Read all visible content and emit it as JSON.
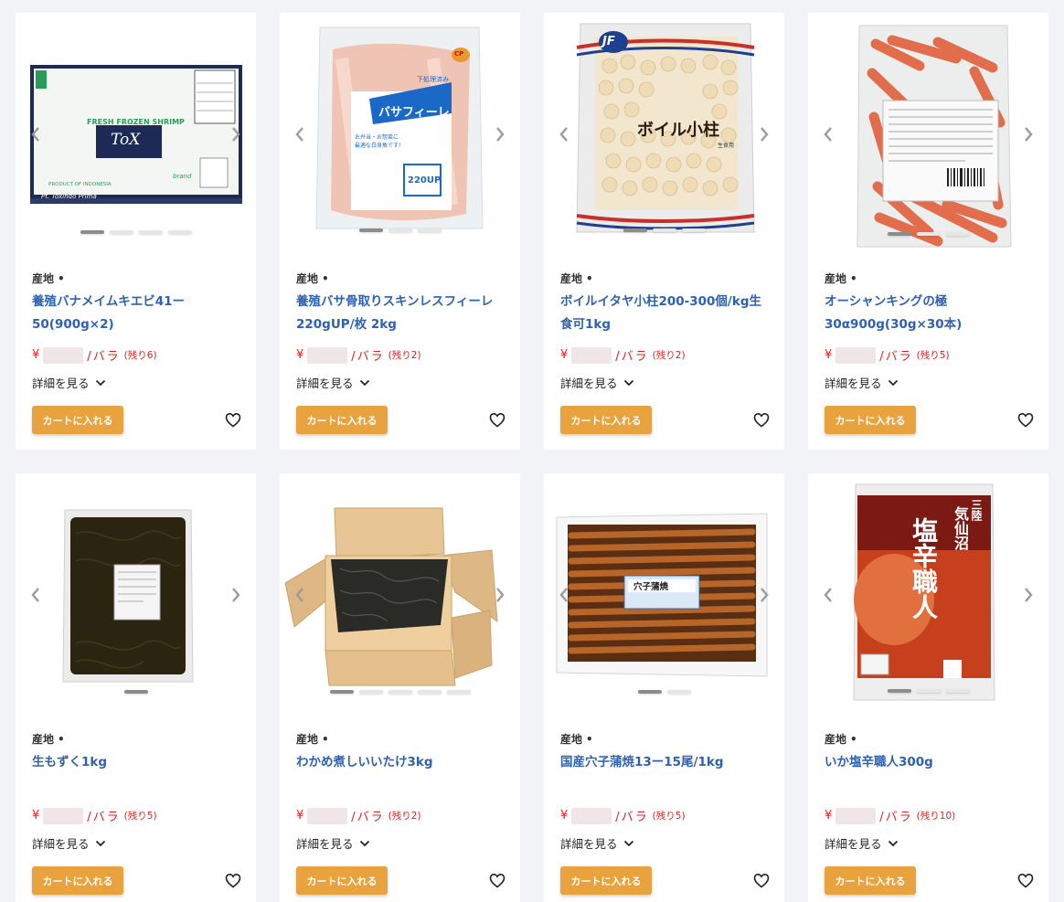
{
  "products": [
    {
      "origin_label": "産地",
      "origin_value": "•",
      "title": "養殖バナメイムキエビ41ー50(900g×2)",
      "currency": "¥",
      "unit": "/バラ",
      "stock": "(残り6)",
      "detail_label": "詳細を見る",
      "cart_label": "カートに入れる",
      "package_text": [
        "FRESH FROZEN SHRIMP",
        "ToX",
        "brand",
        "PRODUCT OF INDONESIA",
        "Pt. Toxindo Prima"
      ],
      "slide_count": 4,
      "active_slide": 0
    },
    {
      "origin_label": "産地",
      "origin_value": "•",
      "title": "養殖バサ骨取りスキンレスフィーレ220gUP/枚 2kg",
      "currency": "¥",
      "unit": "/バラ",
      "stock": "(残り2)",
      "detail_label": "詳細を見る",
      "cart_label": "カートに入れる",
      "package_text": [
        "CP",
        "下処理済み",
        "バサフィーレ",
        "お弁当・お惣菜に最適な白身魚です!",
        "220UP"
      ],
      "slide_count": 3,
      "active_slide": 0
    },
    {
      "origin_label": "産地",
      "origin_value": "•",
      "title": "ボイルイタヤ小柱200-300個/kg生食可1kg",
      "currency": "¥",
      "unit": "/バラ",
      "stock": "(残り2)",
      "detail_label": "詳細を見る",
      "cart_label": "カートに入れる",
      "package_text": [
        "JF",
        "ボイル小柱",
        "生食用"
      ],
      "slide_count": 3,
      "active_slide": 0
    },
    {
      "origin_label": "産地",
      "origin_value": "•",
      "title": "オーシャンキングの極30α900g(30g×30本)",
      "currency": "¥",
      "unit": "/バラ",
      "stock": "(残り5)",
      "detail_label": "詳細を見る",
      "cart_label": "カートに入れる",
      "package_text": [],
      "slide_count": 3,
      "active_slide": 0
    },
    {
      "origin_label": "産地",
      "origin_value": "•",
      "title": "生もずく1kg",
      "currency": "¥",
      "unit": "/バラ",
      "stock": "(残り5)",
      "detail_label": "詳細を見る",
      "cart_label": "カートに入れる",
      "package_text": [],
      "slide_count": 1,
      "active_slide": 0
    },
    {
      "origin_label": "産地",
      "origin_value": "•",
      "title": "わかめ煮しいいたけ3kg",
      "currency": "¥",
      "unit": "/バラ",
      "stock": "(残り2)",
      "detail_label": "詳細を見る",
      "cart_label": "カートに入れる",
      "package_text": [],
      "slide_count": 5,
      "active_slide": 0
    },
    {
      "origin_label": "産地",
      "origin_value": "•",
      "title": "国産穴子蒲焼13ー15尾/1kg",
      "currency": "¥",
      "unit": "/バラ",
      "stock": "(残り5)",
      "detail_label": "詳細を見る",
      "cart_label": "カートに入れる",
      "package_text": [
        "穴子蒲焼"
      ],
      "slide_count": 2,
      "active_slide": 0
    },
    {
      "origin_label": "産地",
      "origin_value": "•",
      "title": "いか塩辛職人300g",
      "currency": "¥",
      "unit": "/バラ",
      "stock": "(残り10)",
      "detail_label": "詳細を見る",
      "cart_label": "カートに入れる",
      "package_text": [
        "三陸",
        "気仙沼",
        "塩辛職人"
      ],
      "slide_count": 3,
      "active_slide": 0
    }
  ],
  "colors": {
    "title": "#2d62b2",
    "price": "#e02020",
    "cart_button": "#e8a23e",
    "background": "#f2f3f7"
  },
  "icons": {
    "prev": "chevron-left-icon",
    "next": "chevron-right-icon",
    "detail": "chevron-down-icon",
    "favorite": "heart-outline-icon"
  }
}
